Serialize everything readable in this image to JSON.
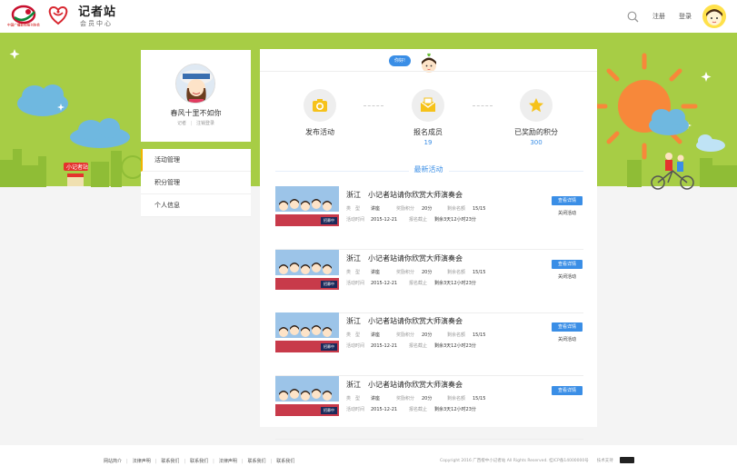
{
  "header": {
    "logo_a_text": "中国广播影视报刊协会",
    "brand_title": "记者站",
    "brand_sub": "会员中心",
    "register": "注册",
    "login": "登录"
  },
  "profile": {
    "name": "春风十里不如你",
    "role": "记者",
    "separator": "|",
    "logout": "注销登录"
  },
  "banner": {
    "station_sign": "小记者站"
  },
  "menu": [
    {
      "label": "活动管理",
      "active": true
    },
    {
      "label": "积分管理",
      "active": false
    },
    {
      "label": "个人信息",
      "active": false
    }
  ],
  "main": {
    "tag": "你好!",
    "stats": [
      {
        "label": "发布活动",
        "value": ""
      },
      {
        "label": "报名成员",
        "value": "19"
      },
      {
        "label": "已奖励的积分",
        "value": "300"
      }
    ],
    "section_title": "最新活动",
    "activities": [
      {
        "title": "浙江　小记者站请你欣赏大师演奏会",
        "type_k": "类　型",
        "type_v": "讲座",
        "points_k": "奖励积分",
        "points_v": "20分",
        "quota_k": "剩余名额",
        "quota_v": "15/15",
        "time_k": "活动时间",
        "time_v": "2015-12-21",
        "deadline_k": "报名截止",
        "deadline_v": "剩余3天12小时23分",
        "thumb_tag": "招募中",
        "detail": "查看详情",
        "close": "关闭活动"
      },
      {
        "title": "浙江　小记者站请你欣赏大师演奏会",
        "type_k": "类　型",
        "type_v": "讲座",
        "points_k": "奖励积分",
        "points_v": "20分",
        "quota_k": "剩余名额",
        "quota_v": "15/15",
        "time_k": "活动时间",
        "time_v": "2015-12-21",
        "deadline_k": "报名截止",
        "deadline_v": "剩余3天12小时23分",
        "thumb_tag": "招募中",
        "detail": "查看详情",
        "close": "关闭活动"
      },
      {
        "title": "浙江　小记者站请你欣赏大师演奏会",
        "type_k": "类　型",
        "type_v": "讲座",
        "points_k": "奖励积分",
        "points_v": "20分",
        "quota_k": "剩余名额",
        "quota_v": "15/15",
        "time_k": "活动时间",
        "time_v": "2015-12-21",
        "deadline_k": "报名截止",
        "deadline_v": "剩余3天12小时23分",
        "thumb_tag": "招募中",
        "detail": "查看详情",
        "close": "关闭活动"
      },
      {
        "title": "浙江　小记者站请你欣赏大师演奏会",
        "type_k": "类　型",
        "type_v": "讲座",
        "points_k": "奖励积分",
        "points_v": "20分",
        "quota_k": "剩余名额",
        "quota_v": "15/15",
        "time_k": "活动时间",
        "time_v": "2015-12-21",
        "deadline_k": "报名截止",
        "deadline_v": "剩余3天12小时23分",
        "thumb_tag": "招募中",
        "detail": "查看详情",
        "close": ""
      }
    ]
  },
  "footer": {
    "links": [
      "网站简介",
      "法律声明",
      "联系我们",
      "联系我们",
      "法律声明",
      "联系我们",
      "联系我们"
    ],
    "copyright": "Copyright 2016 广西橙中小记者站 All Rights Reserved. 桂ICP备14000000号　　技术支持"
  },
  "colors": {
    "accent": "#3a8ee6",
    "banner_green": "#a7cd45",
    "menu_active": "#f0b400",
    "sun": "#f7883a"
  }
}
